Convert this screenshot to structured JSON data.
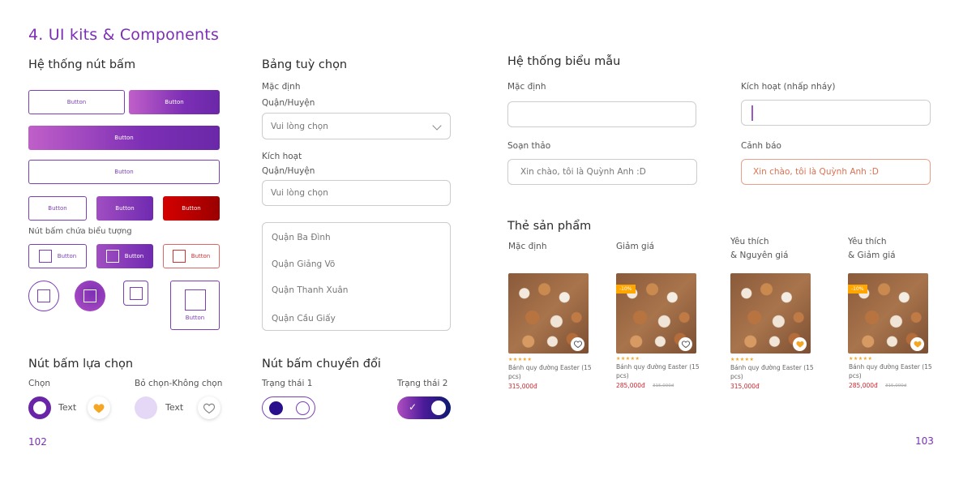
{
  "title": "4. UI kits & Components",
  "buttons": {
    "heading": "Hệ thống nút bấm",
    "label": "Button",
    "icon_heading": "Nút bấm chứa biểu tượng"
  },
  "select": {
    "heading": "Bảng tuỳ chọn",
    "default_state": "Mặc định",
    "field_label": "Quận/Huyện",
    "placeholder": "Vui lòng chọn",
    "active_state": "Kích hoạt",
    "options": [
      "Quận Ba Đình",
      "Quận Giảng Võ",
      "Quận Thanh Xuân",
      "Quận Cầu Giấy"
    ]
  },
  "choice": {
    "heading": "Nút bấm lựa chọn",
    "selected": "Chọn",
    "unselected": "Bỏ chọn-Không chọn",
    "text": "Text"
  },
  "switch": {
    "heading": "Nút bấm chuyển đổi",
    "state1": "Trạng thái 1",
    "state2": "Trạng thái 2",
    "check": "✓"
  },
  "forms": {
    "heading": "Hệ thống biểu mẫu",
    "default_state": "Mặc định",
    "active_state": "Kích hoạt (nhấp nháy)",
    "edit_state": "Soạn thảo",
    "warn_state": "Cảnh báo",
    "sample_text": "Xin chào, tôi là Quỳnh Anh :D"
  },
  "products": {
    "heading": "Thẻ sản phẩm",
    "cards": [
      {
        "label1": "Mặc định",
        "label2": "",
        "badge": "",
        "liked": false,
        "stars": "★★★★★",
        "name": "Bánh quy đường Easter (15 pcs)",
        "price": "315,000đ",
        "old_price": ""
      },
      {
        "label1": "Giảm giá",
        "label2": "",
        "badge": "-10%",
        "liked": false,
        "stars": "★★★★★",
        "name": "Bánh quy đường Easter (15 pcs)",
        "price": "285,000đ",
        "old_price": "315,000đ"
      },
      {
        "label1": "Yêu thích",
        "label2": "& Nguyên giá",
        "badge": "",
        "liked": true,
        "stars": "★★★★★",
        "name": "Bánh quy đường Easter (15 pcs)",
        "price": "315,000đ",
        "old_price": ""
      },
      {
        "label1": "Yêu thích",
        "label2": "& Giảm giá",
        "badge": "-10%",
        "liked": true,
        "stars": "★★★★★",
        "name": "Bánh quy đường Easter (15 pcs)",
        "price": "285,000đ",
        "old_price": "315,000đ"
      }
    ]
  },
  "pages": {
    "left": "102",
    "right": "103"
  },
  "colors": {
    "primary": "#7b2fb5",
    "accent_orange": "#ffa600",
    "danger": "#d50000",
    "price_red": "#d0262e"
  },
  "icons": {
    "heart": "heart-icon",
    "chevron": "chevron-down-icon",
    "square": "square-icon",
    "check": "check-icon"
  }
}
